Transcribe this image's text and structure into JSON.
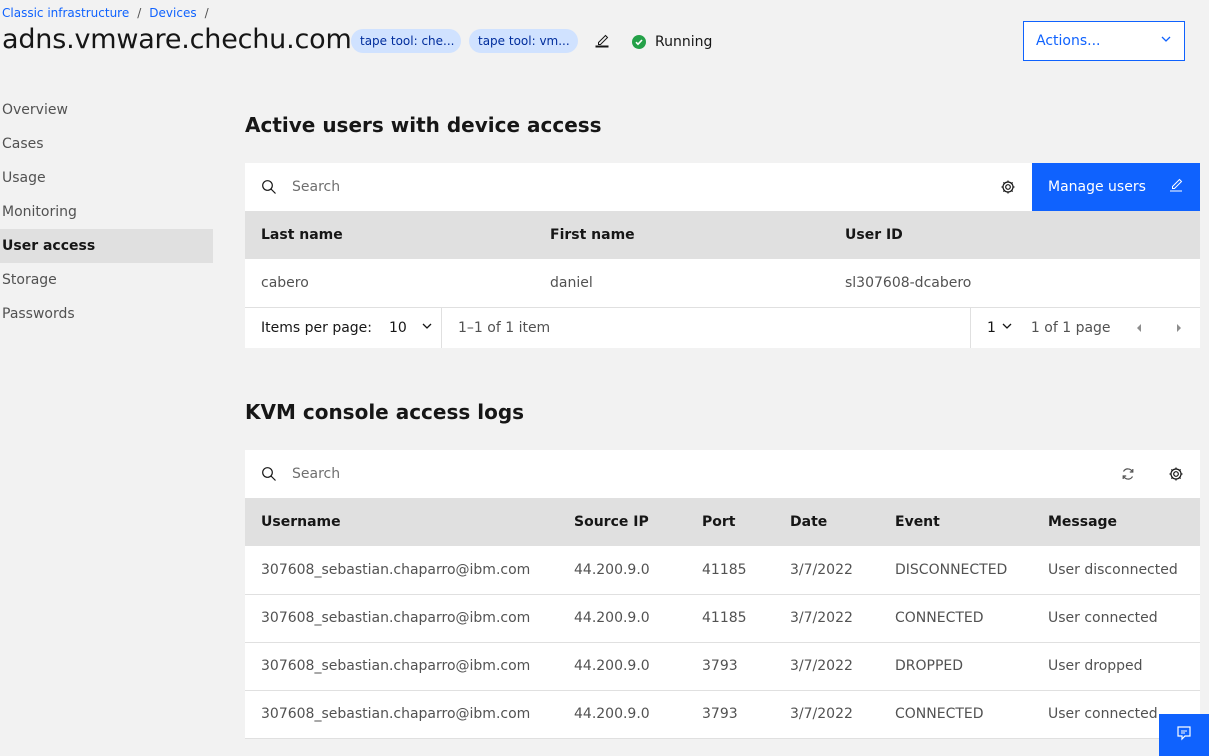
{
  "breadcrumb": {
    "items": [
      "Classic infrastructure",
      "Devices"
    ],
    "separator": "/"
  },
  "header": {
    "title": "adns.vmware.chechu.com",
    "tags": [
      "tape tool: che...",
      "tape tool: vm..."
    ],
    "status": "Running",
    "actions_label": "Actions..."
  },
  "sidebar": {
    "items": [
      {
        "label": "Overview"
      },
      {
        "label": "Cases"
      },
      {
        "label": "Usage"
      },
      {
        "label": "Monitoring"
      },
      {
        "label": "User access"
      },
      {
        "label": "Storage"
      },
      {
        "label": "Passwords"
      }
    ],
    "active": "User access"
  },
  "users_section": {
    "title": "Active users with device access",
    "search_placeholder": "Search",
    "manage_button": "Manage users",
    "columns": [
      "Last name",
      "First name",
      "User ID"
    ],
    "rows": [
      [
        "cabero",
        "daniel",
        "sl307608-dcabero"
      ]
    ],
    "pagination": {
      "items_per_page_label": "Items per page:",
      "items_per_page": "10",
      "range": "1–1 of 1 item",
      "page": "1",
      "page_of": "1 of 1 page"
    }
  },
  "kvm_section": {
    "title": "KVM console access logs",
    "search_placeholder": "Search",
    "columns": [
      "Username",
      "Source IP",
      "Port",
      "Date",
      "Event",
      "Message"
    ],
    "rows": [
      [
        "307608_sebastian.chaparro@ibm.com",
        "44.200.9.0",
        "41185",
        "3/7/2022",
        "DISCONNECTED",
        "User disconnected"
      ],
      [
        "307608_sebastian.chaparro@ibm.com",
        "44.200.9.0",
        "41185",
        "3/7/2022",
        "CONNECTED",
        "User connected"
      ],
      [
        "307608_sebastian.chaparro@ibm.com",
        "44.200.9.0",
        "3793",
        "3/7/2022",
        "DROPPED",
        "User dropped"
      ],
      [
        "307608_sebastian.chaparro@ibm.com",
        "44.200.9.0",
        "3793",
        "3/7/2022",
        "CONNECTED",
        "User connected"
      ]
    ]
  },
  "colors": {
    "accent": "#0f62fe",
    "status_running": "#24a148",
    "tag_bg": "#d0e2ff"
  },
  "icons": [
    "search-icon",
    "gear-icon",
    "refresh-icon",
    "edit-icon",
    "chevron-down-icon",
    "caret-left-icon",
    "caret-right-icon",
    "checkmark-icon",
    "feedback-icon"
  ]
}
